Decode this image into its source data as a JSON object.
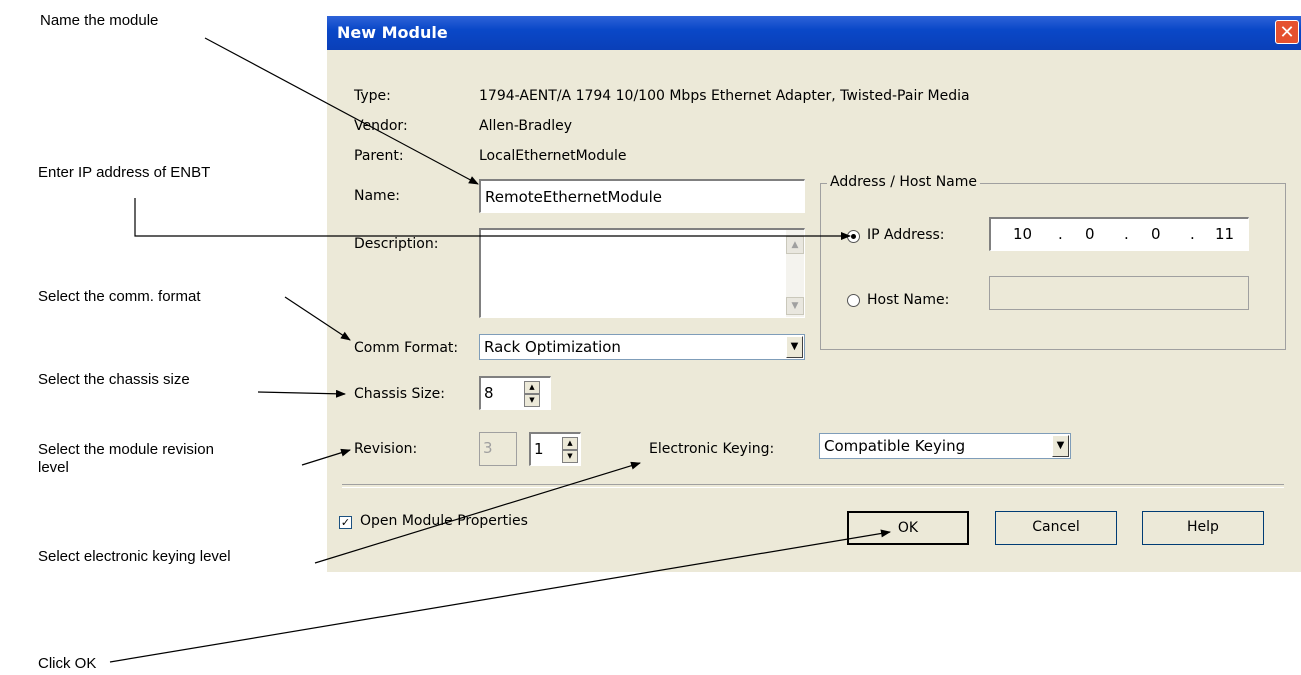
{
  "annotations": {
    "name_module": "Name the module",
    "enter_ip": "Enter IP address of ENBT",
    "comm_format": "Select the comm. format",
    "chassis_size": "Select the chassis size",
    "revision_line1": "Select the module revision",
    "revision_line2": "level",
    "keying": "Select electronic keying level",
    "click_ok": "Click OK"
  },
  "dialog": {
    "title": "New Module",
    "close_glyph": "✕",
    "type_label": "Type:",
    "type_value": "1794-AENT/A 1794 10/100 Mbps Ethernet Adapter, Twisted-Pair Media",
    "vendor_label": "Vendor:",
    "vendor_value": "Allen-Bradley",
    "parent_label": "Parent:",
    "parent_value": "LocalEthernetModule",
    "name_label": "Name:",
    "name_value": "RemoteEthernetModule",
    "description_label": "Description:",
    "description_value": "",
    "comm_format_label": "Comm Format:",
    "comm_format_value": "Rack Optimization",
    "chassis_size_label": "Chassis Size:",
    "chassis_size_value": "8",
    "revision_label": "Revision:",
    "revision_major": "3",
    "revision_minor": "1",
    "keying_label": "Electronic Keying:",
    "keying_value": "Compatible Keying",
    "address_group_label": "Address / Host Name",
    "ip_radio_label": "IP Address:",
    "ip_octets": [
      "10",
      "0",
      "0",
      "11"
    ],
    "ip_selected": true,
    "host_radio_label": "Host Name:",
    "host_value": "",
    "open_props_label": "Open Module Properties",
    "open_props_checked": true,
    "ok_label": "OK",
    "cancel_label": "Cancel",
    "help_label": "Help"
  },
  "icons": {
    "dropdown_arrow": "▼",
    "spin_up": "▲",
    "spin_down": "▼",
    "check": "✓",
    "scroll_up": "▲",
    "scroll_down": "▼"
  },
  "colors": {
    "title_bar": "#0a48c8",
    "dialog_bg": "#ece9d8",
    "close_button": "#e5512f"
  }
}
